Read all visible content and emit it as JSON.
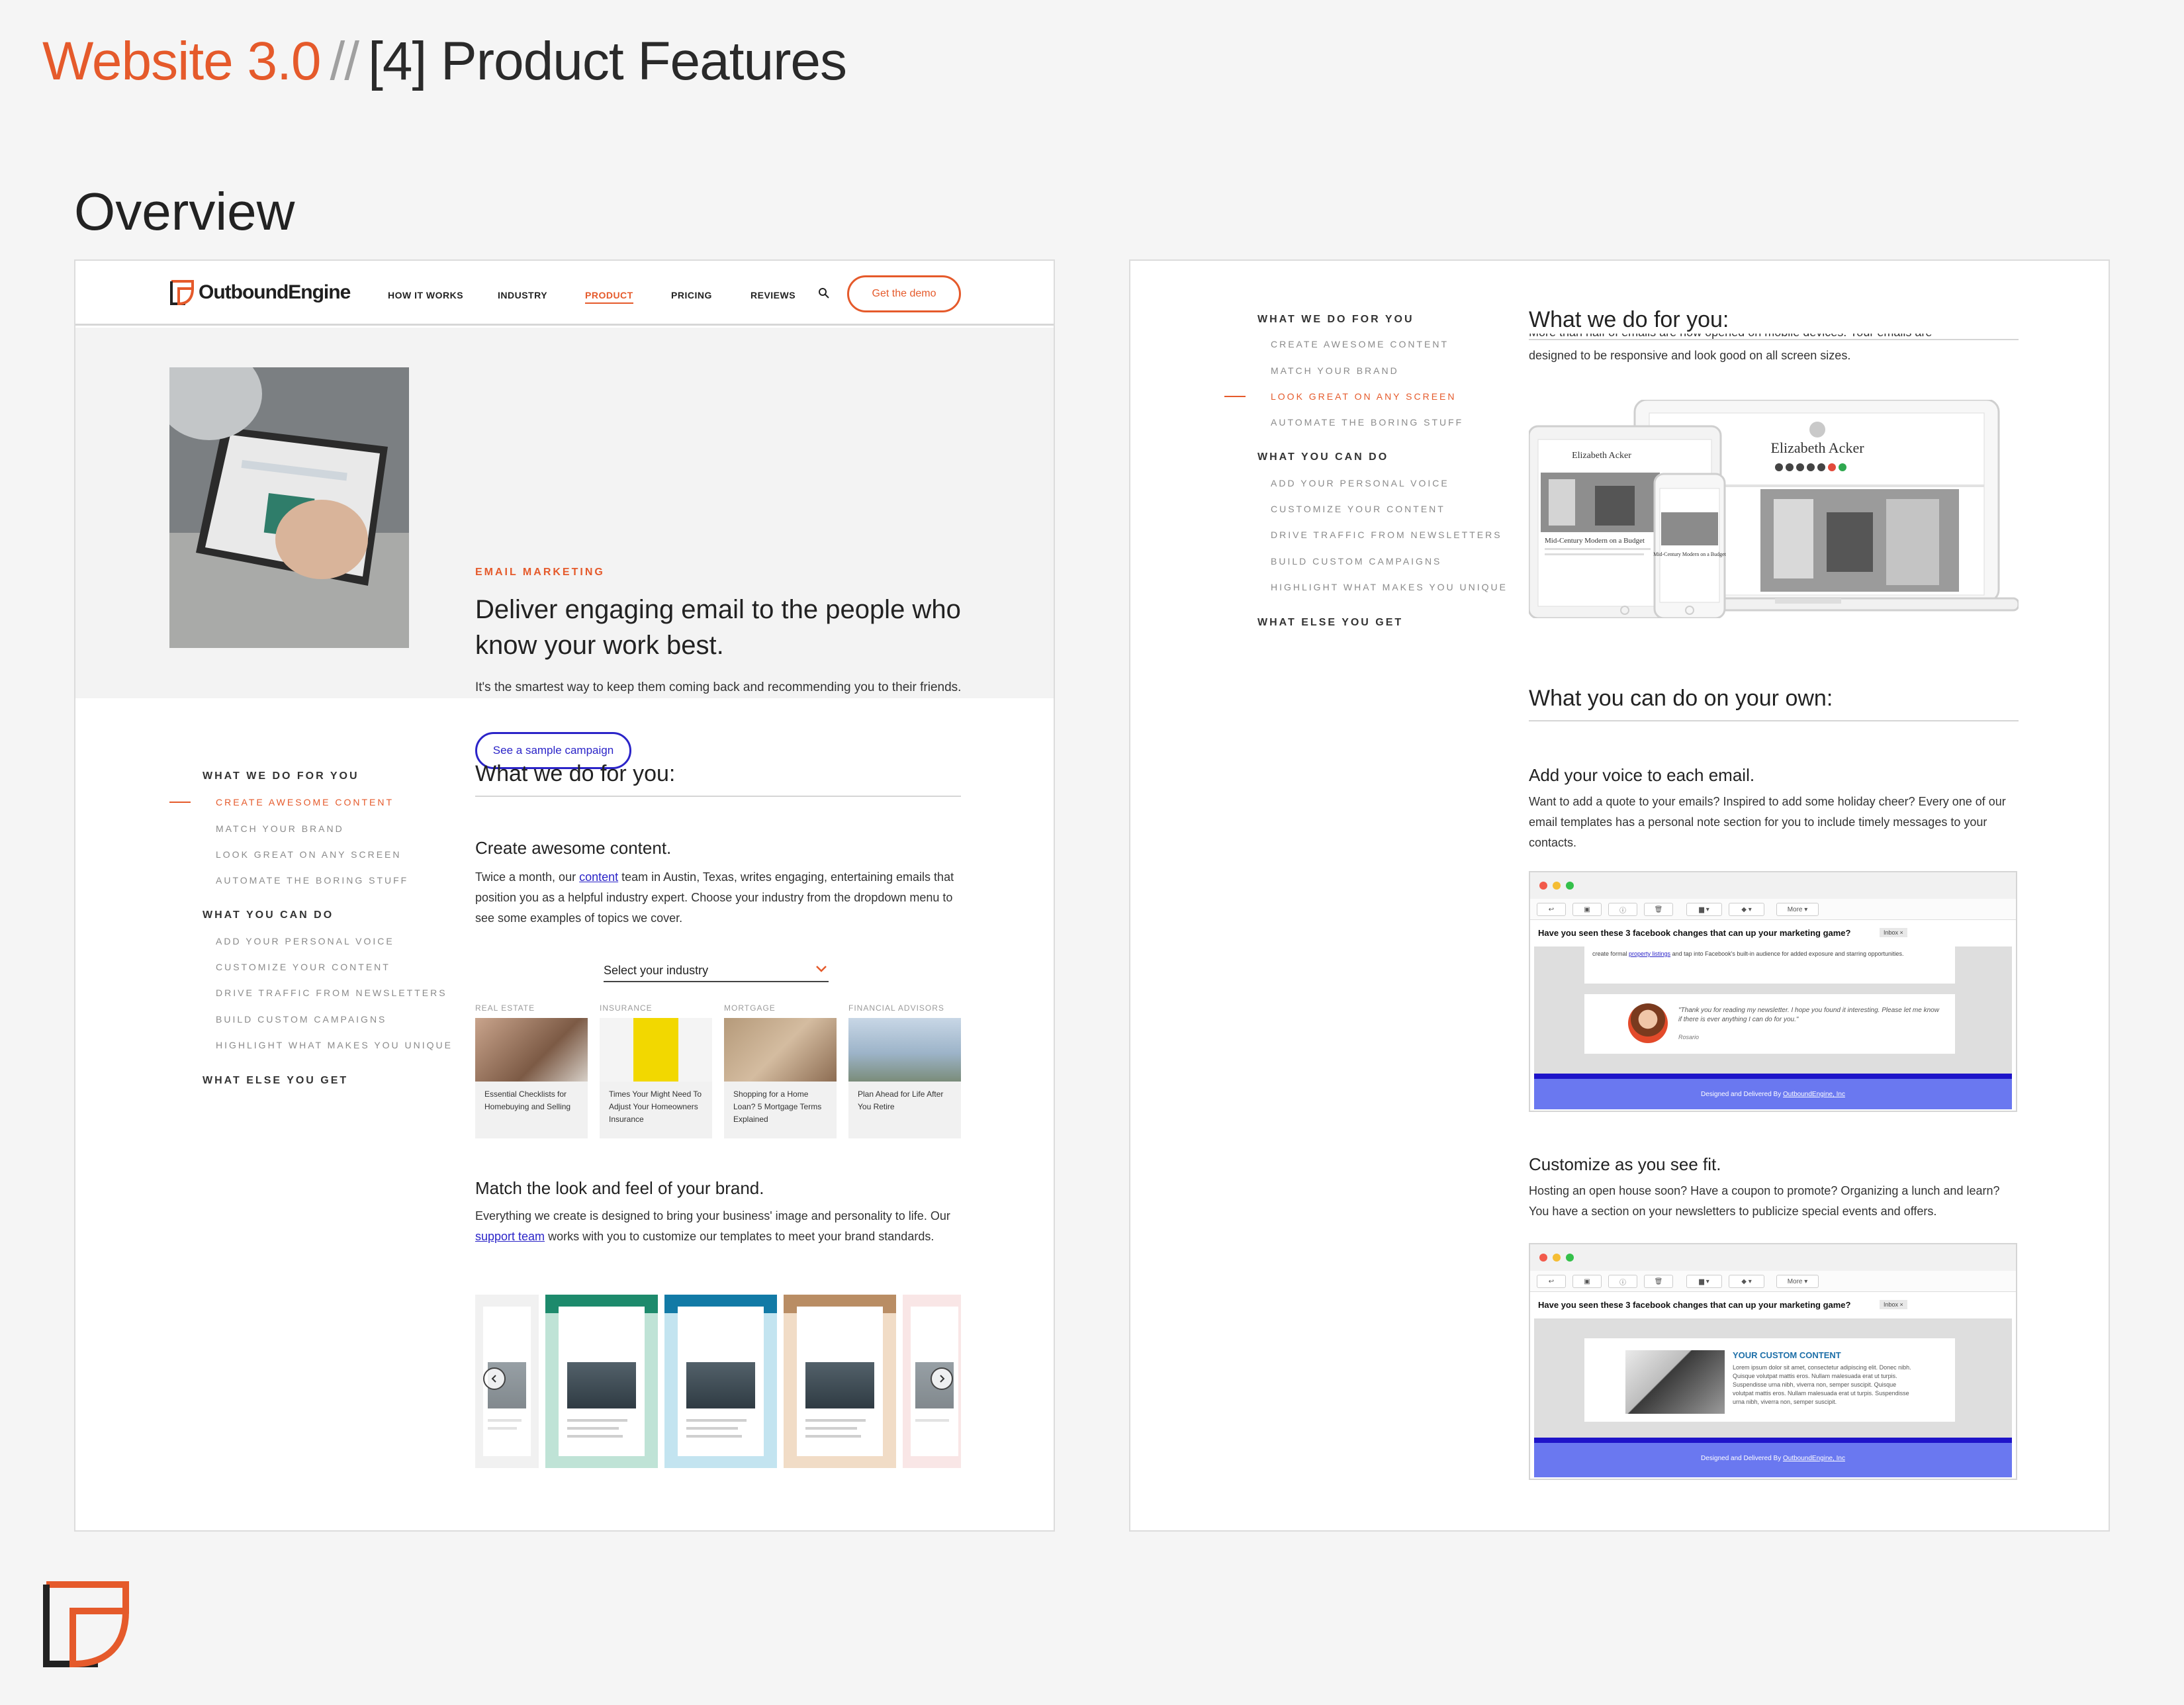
{
  "deck": {
    "title_part1": "Website 3.0",
    "title_sep": "//",
    "title_part2": "[4] Product Features",
    "subtitle": "Overview"
  },
  "colors": {
    "accent": "#e55a2b",
    "link": "#2b24c8",
    "text": "#222222"
  },
  "navbar": {
    "logo_text": "OutboundEngine",
    "items": [
      "HOW IT WORKS",
      "INDUSTRY",
      "PRODUCT",
      "PRICING",
      "REVIEWS"
    ],
    "active_item": "PRODUCT",
    "search_icon": "search-icon",
    "demo_button": "Get the demo"
  },
  "hero": {
    "eyebrow": "EMAIL MARKETING",
    "title": "Deliver engaging email to the people who know your work best.",
    "description": "It's the smartest way to keep them coming back and recommending you to their friends.",
    "button": "See a sample campaign"
  },
  "sidenav_left": {
    "sec1": "WHAT WE DO FOR YOU",
    "items1": [
      "CREATE AWESOME CONTENT",
      "MATCH YOUR BRAND",
      "LOOK GREAT ON ANY SCREEN",
      "AUTOMATE THE BORING STUFF"
    ],
    "sec2": "WHAT YOU CAN DO",
    "items2": [
      "ADD YOUR PERSONAL VOICE",
      "CUSTOMIZE YOUR CONTENT",
      "DRIVE TRAFFIC FROM NEWSLETTERS",
      "BUILD CUSTOM CAMPAIGNS",
      "HIGHLIGHT WHAT MAKES YOU UNIQUE"
    ],
    "sec3": "WHAT ELSE YOU GET",
    "active": "CREATE AWESOME CONTENT"
  },
  "sidenav_right": {
    "sec1": "WHAT WE DO FOR YOU",
    "items1": [
      "CREATE AWESOME CONTENT",
      "MATCH YOUR BRAND",
      "LOOK GREAT ON ANY SCREEN",
      "AUTOMATE THE BORING STUFF"
    ],
    "sec2": "WHAT YOU CAN DO",
    "items2": [
      "ADD YOUR PERSONAL VOICE",
      "CUSTOMIZE YOUR CONTENT",
      "DRIVE TRAFFIC FROM NEWSLETTERS",
      "BUILD CUSTOM CAMPAIGNS",
      "HIGHLIGHT WHAT MAKES YOU UNIQUE"
    ],
    "sec3": "WHAT ELSE YOU GET",
    "active": "LOOK GREAT ON ANY SCREEN"
  },
  "left_content": {
    "section_title": "What we do for you:",
    "create_title": "Create awesome content.",
    "create_p_a": "Twice a month, our ",
    "create_p_link": "content",
    "create_p_b": " team in Austin, Texas, writes engaging, entertaining emails that position you as a helpful industry expert. Choose your industry from the dropdown menu to see some examples of topics we cover.",
    "dropdown": "Select your industry",
    "cards": [
      {
        "category": "REAL ESTATE",
        "title": "Essential Checklists for Homebuying and Selling"
      },
      {
        "category": "INSURANCE",
        "title": "Times Your Might Need To Adjust Your Homeowners Insurance"
      },
      {
        "category": "MORTGAGE",
        "title": "Shopping for a Home Loan? 5 Mortgage Terms Explained"
      },
      {
        "category": "FINANCIAL ADVISORS",
        "title": "Plan Ahead for Life After You Retire"
      }
    ],
    "brand_title": "Match the look and feel of your brand.",
    "brand_p_a": "Everything we create is designed to bring your business' image and personality to life. Our ",
    "brand_p_link": "support team",
    "brand_p_b": " works with you to customize our templates to meet your brand standards."
  },
  "right_content": {
    "section_title": "What we do for you:",
    "cut_text": "More than half of emails are now opened on mobile devices. Your emails are",
    "para1": "designed to be responsive and look good on all screen sizes.",
    "device_name": "Elizabeth Acker",
    "device_tagline": "Mid-Century Modern on a Budget",
    "own_title": "What you can do on your own:",
    "voice_title": "Add your voice to each email.",
    "voice_p": "Want to add a quote to your emails? Inspired to add some holiday cheer? Every one of our email templates has a personal note section for you to include timely messages to your contacts.",
    "custom_title": "Customize as you see fit.",
    "custom_p": "Hosting an open house soon? Have a coupon to promote? Organizing a lunch and learn? You have a section on your newsletters to publicize special events and offers."
  },
  "email1": {
    "tools": [
      "↩",
      "▣",
      "ⓘ",
      "🗑",
      "▆ ▾",
      "◆ ▾",
      "More ▾"
    ],
    "subject": "Have you seen these 3 facebook changes that can up your marketing game?",
    "badge": "Inbox ×",
    "snippet_a": "create formal ",
    "snippet_link": "property listings",
    "snippet_b": " and tap into Facebook's built-in audience for added exposure and starring opportunities.",
    "quote": "\"Thank you for reading my newsletter. I hope you found it interesting. Please let me know if there is ever anything I can do for you.\"",
    "signature": "Rosario",
    "footer_a": "Designed and Delivered By ",
    "footer_link": "OutboundEngine, Inc"
  },
  "email2": {
    "tools": [
      "↩",
      "▣",
      "ⓘ",
      "🗑",
      "▆ ▾",
      "◆ ▾",
      "More ▾"
    ],
    "subject": "Have you seen these 3 facebook changes that can up your marketing game?",
    "badge": "Inbox ×",
    "custom_heading": "YOUR CUSTOM CONTENT",
    "custom_text": "Lorem ipsum dolor sit amet, consectetur adipiscing elit. Donec nibh. Quisque volutpat mattis eros. Nullam malesuada erat ut turpis. Suspendisse urna nibh, viverra non, semper suscipit. Quisque volutpat mattis eros. Nullam malesuada erat ut turpis. Suspendisse urna nibh, viverra non, semper suscipit.",
    "footer_a": "Designed and Delivered By ",
    "footer_link": "OutboundEngine, Inc"
  }
}
